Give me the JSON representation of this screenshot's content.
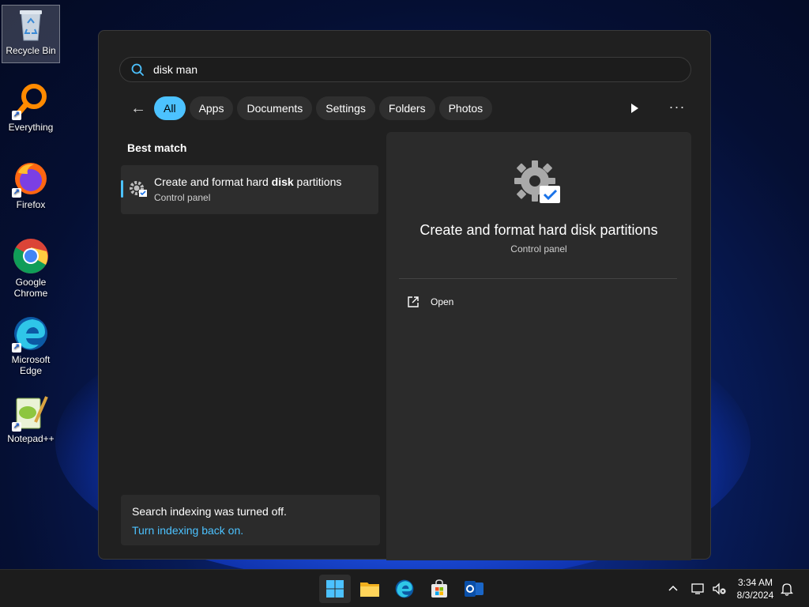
{
  "desktop": {
    "icons": [
      {
        "label": "Recycle Bin"
      },
      {
        "label": "Everything"
      },
      {
        "label": "Firefox"
      },
      {
        "label": "Google Chrome"
      },
      {
        "label": "Microsoft Edge"
      },
      {
        "label": "Notepad++"
      }
    ]
  },
  "search": {
    "query": "disk man",
    "filters": [
      "All",
      "Apps",
      "Documents",
      "Settings",
      "Folders",
      "Photos"
    ],
    "active_filter": "All",
    "best_match_label": "Best match",
    "result": {
      "title_pre": "Create and format hard ",
      "title_bold": "disk",
      "title_post": " partitions",
      "subtitle": "Control panel"
    },
    "indexing": {
      "message": "Search indexing was turned off.",
      "link": "Turn indexing back on."
    },
    "detail": {
      "title": "Create and format hard disk partitions",
      "subtitle": "Control panel",
      "action_open": "Open"
    }
  },
  "taskbar": {
    "time": "3:34 AM",
    "date": "8/3/2024"
  },
  "colors": {
    "accent": "#4cc2ff",
    "panel_bg": "#202020",
    "detail_bg": "#2b2b2b"
  }
}
